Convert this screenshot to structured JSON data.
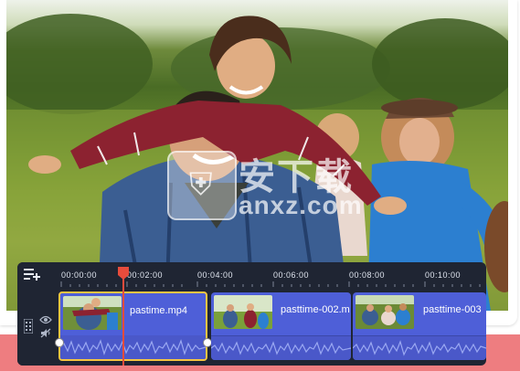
{
  "watermark": {
    "chinese": "安下载",
    "site": "anxz.com"
  },
  "timeline": {
    "ruler_labels": [
      "00:00:00",
      "00:02:00",
      "00:04:00",
      "00:06:00",
      "00:08:00",
      "00:10:00"
    ],
    "clips": [
      {
        "name": "pastime.mp4",
        "selected": true
      },
      {
        "name": "pasttime-002.m"
      },
      {
        "name": "pasttime-003"
      }
    ],
    "icons": [
      "add-track-icon",
      "eye-icon",
      "mute-icon",
      "track-handle-icon"
    ],
    "colors": {
      "panel": "#1f2533",
      "clip": "#4e5fd8",
      "selection": "#f5c542",
      "playhead": "#e74c3c",
      "accent": "#ee7d80"
    }
  }
}
